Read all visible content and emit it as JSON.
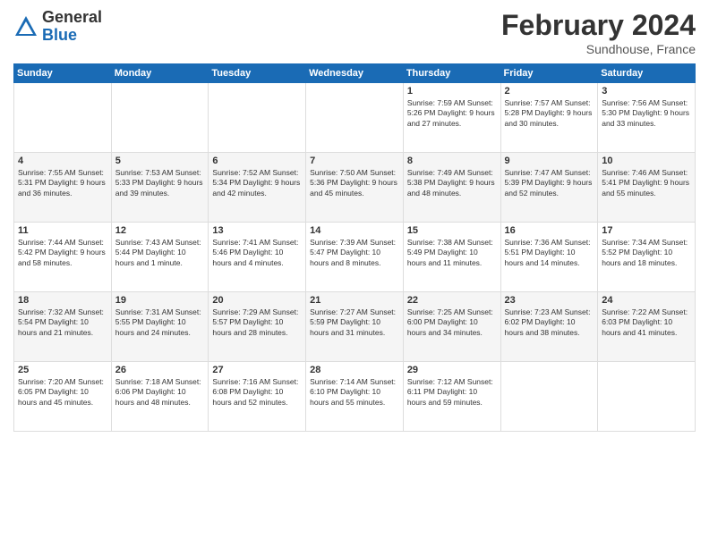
{
  "logo": {
    "general": "General",
    "blue": "Blue"
  },
  "header": {
    "month": "February 2024",
    "location": "Sundhouse, France"
  },
  "days_of_week": [
    "Sunday",
    "Monday",
    "Tuesday",
    "Wednesday",
    "Thursday",
    "Friday",
    "Saturday"
  ],
  "weeks": [
    [
      {
        "day": "",
        "info": ""
      },
      {
        "day": "",
        "info": ""
      },
      {
        "day": "",
        "info": ""
      },
      {
        "day": "",
        "info": ""
      },
      {
        "day": "1",
        "info": "Sunrise: 7:59 AM\nSunset: 5:26 PM\nDaylight: 9 hours\nand 27 minutes."
      },
      {
        "day": "2",
        "info": "Sunrise: 7:57 AM\nSunset: 5:28 PM\nDaylight: 9 hours\nand 30 minutes."
      },
      {
        "day": "3",
        "info": "Sunrise: 7:56 AM\nSunset: 5:30 PM\nDaylight: 9 hours\nand 33 minutes."
      }
    ],
    [
      {
        "day": "4",
        "info": "Sunrise: 7:55 AM\nSunset: 5:31 PM\nDaylight: 9 hours\nand 36 minutes."
      },
      {
        "day": "5",
        "info": "Sunrise: 7:53 AM\nSunset: 5:33 PM\nDaylight: 9 hours\nand 39 minutes."
      },
      {
        "day": "6",
        "info": "Sunrise: 7:52 AM\nSunset: 5:34 PM\nDaylight: 9 hours\nand 42 minutes."
      },
      {
        "day": "7",
        "info": "Sunrise: 7:50 AM\nSunset: 5:36 PM\nDaylight: 9 hours\nand 45 minutes."
      },
      {
        "day": "8",
        "info": "Sunrise: 7:49 AM\nSunset: 5:38 PM\nDaylight: 9 hours\nand 48 minutes."
      },
      {
        "day": "9",
        "info": "Sunrise: 7:47 AM\nSunset: 5:39 PM\nDaylight: 9 hours\nand 52 minutes."
      },
      {
        "day": "10",
        "info": "Sunrise: 7:46 AM\nSunset: 5:41 PM\nDaylight: 9 hours\nand 55 minutes."
      }
    ],
    [
      {
        "day": "11",
        "info": "Sunrise: 7:44 AM\nSunset: 5:42 PM\nDaylight: 9 hours\nand 58 minutes."
      },
      {
        "day": "12",
        "info": "Sunrise: 7:43 AM\nSunset: 5:44 PM\nDaylight: 10 hours\nand 1 minute."
      },
      {
        "day": "13",
        "info": "Sunrise: 7:41 AM\nSunset: 5:46 PM\nDaylight: 10 hours\nand 4 minutes."
      },
      {
        "day": "14",
        "info": "Sunrise: 7:39 AM\nSunset: 5:47 PM\nDaylight: 10 hours\nand 8 minutes."
      },
      {
        "day": "15",
        "info": "Sunrise: 7:38 AM\nSunset: 5:49 PM\nDaylight: 10 hours\nand 11 minutes."
      },
      {
        "day": "16",
        "info": "Sunrise: 7:36 AM\nSunset: 5:51 PM\nDaylight: 10 hours\nand 14 minutes."
      },
      {
        "day": "17",
        "info": "Sunrise: 7:34 AM\nSunset: 5:52 PM\nDaylight: 10 hours\nand 18 minutes."
      }
    ],
    [
      {
        "day": "18",
        "info": "Sunrise: 7:32 AM\nSunset: 5:54 PM\nDaylight: 10 hours\nand 21 minutes."
      },
      {
        "day": "19",
        "info": "Sunrise: 7:31 AM\nSunset: 5:55 PM\nDaylight: 10 hours\nand 24 minutes."
      },
      {
        "day": "20",
        "info": "Sunrise: 7:29 AM\nSunset: 5:57 PM\nDaylight: 10 hours\nand 28 minutes."
      },
      {
        "day": "21",
        "info": "Sunrise: 7:27 AM\nSunset: 5:59 PM\nDaylight: 10 hours\nand 31 minutes."
      },
      {
        "day": "22",
        "info": "Sunrise: 7:25 AM\nSunset: 6:00 PM\nDaylight: 10 hours\nand 34 minutes."
      },
      {
        "day": "23",
        "info": "Sunrise: 7:23 AM\nSunset: 6:02 PM\nDaylight: 10 hours\nand 38 minutes."
      },
      {
        "day": "24",
        "info": "Sunrise: 7:22 AM\nSunset: 6:03 PM\nDaylight: 10 hours\nand 41 minutes."
      }
    ],
    [
      {
        "day": "25",
        "info": "Sunrise: 7:20 AM\nSunset: 6:05 PM\nDaylight: 10 hours\nand 45 minutes."
      },
      {
        "day": "26",
        "info": "Sunrise: 7:18 AM\nSunset: 6:06 PM\nDaylight: 10 hours\nand 48 minutes."
      },
      {
        "day": "27",
        "info": "Sunrise: 7:16 AM\nSunset: 6:08 PM\nDaylight: 10 hours\nand 52 minutes."
      },
      {
        "day": "28",
        "info": "Sunrise: 7:14 AM\nSunset: 6:10 PM\nDaylight: 10 hours\nand 55 minutes."
      },
      {
        "day": "29",
        "info": "Sunrise: 7:12 AM\nSunset: 6:11 PM\nDaylight: 10 hours\nand 59 minutes."
      },
      {
        "day": "",
        "info": ""
      },
      {
        "day": "",
        "info": ""
      }
    ]
  ]
}
